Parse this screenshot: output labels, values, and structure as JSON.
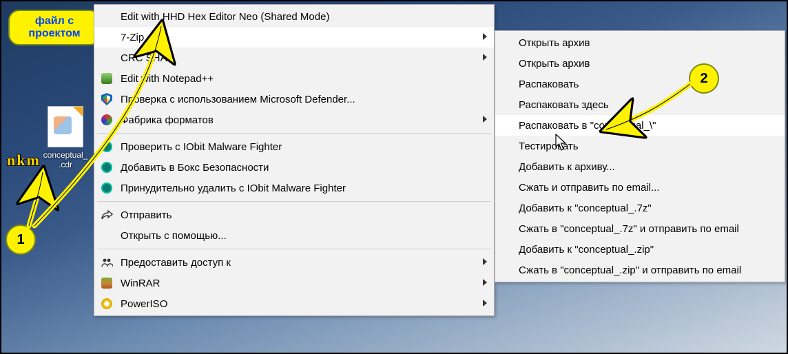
{
  "callout": {
    "line1": "файл с",
    "line2": "проектом"
  },
  "badges": {
    "one": "1",
    "two": "2"
  },
  "watermark": "nkm",
  "desktop_icon": {
    "label_line1": "conceptual_",
    "label_line2": ".cdr"
  },
  "menu": {
    "items": [
      {
        "label": "Edit with HHD Hex Editor Neo (Shared Mode)",
        "icon": "",
        "submenu": false
      },
      {
        "label": "7-Zip",
        "icon": "",
        "submenu": true,
        "hover": true
      },
      {
        "label": "CRC SHA",
        "icon": "",
        "submenu": true
      },
      {
        "label": "Edit with Notepad++",
        "icon": "np",
        "submenu": false
      },
      {
        "label": "Проверка с использованием Microsoft Defender...",
        "icon": "defender",
        "submenu": false
      },
      {
        "label": "Фабрика форматов",
        "icon": "ff",
        "submenu": true
      },
      "sep",
      {
        "label": "Проверить с IObit Malware Fighter",
        "icon": "iobit",
        "submenu": false
      },
      {
        "label": "Добавить в Бокс Безопасности",
        "icon": "iobit",
        "submenu": false
      },
      {
        "label": "Принудительно удалить с IObit Malware Fighter",
        "icon": "iobit",
        "submenu": false
      },
      "sep",
      {
        "label": "Отправить",
        "icon": "share",
        "submenu": false
      },
      {
        "label": "Открыть с помощью...",
        "icon": "",
        "submenu": false
      },
      "sep",
      {
        "label": "Предоставить доступ к",
        "icon": "people",
        "submenu": true
      },
      {
        "label": "WinRAR",
        "icon": "winrar",
        "submenu": true
      },
      {
        "label": "PowerISO",
        "icon": "poweriso",
        "submenu": true
      }
    ]
  },
  "submenu": {
    "items": [
      "Открыть архив",
      "Открыть архив",
      "Распаковать",
      "Распаковать здесь",
      "Распаковать в \"conceptual_\\\"",
      "Тестировать",
      "Добавить к архиву...",
      "Сжать и отправить по email...",
      "Добавить к \"conceptual_.7z\"",
      "Сжать в \"conceptual_.7z\" и отправить по email",
      "Добавить к \"conceptual_.zip\"",
      "Сжать в \"conceptual_.zip\" и отправить по email"
    ],
    "hover_index": 4
  }
}
